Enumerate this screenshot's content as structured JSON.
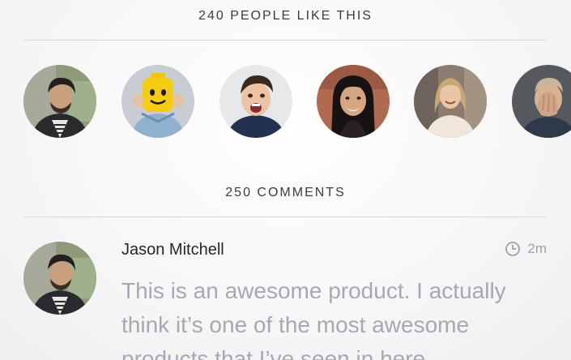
{
  "likes": {
    "title": "240 PEOPLE LIKE THIS"
  },
  "avatars": [
    {
      "name": "avatar-bearded-man"
    },
    {
      "name": "avatar-lego-head"
    },
    {
      "name": "avatar-excited-man"
    },
    {
      "name": "avatar-smiling-woman"
    },
    {
      "name": "avatar-blonde-woman"
    },
    {
      "name": "avatar-hand-on-face"
    }
  ],
  "comments": {
    "title": "250 COMMENTS",
    "items": [
      {
        "author": "Jason Mitchell",
        "time": "2m",
        "time_icon": "clock-icon",
        "text": "This is an awesome product. I actually think it’s one of the most awesome products that I’ve seen in here"
      }
    ]
  }
}
